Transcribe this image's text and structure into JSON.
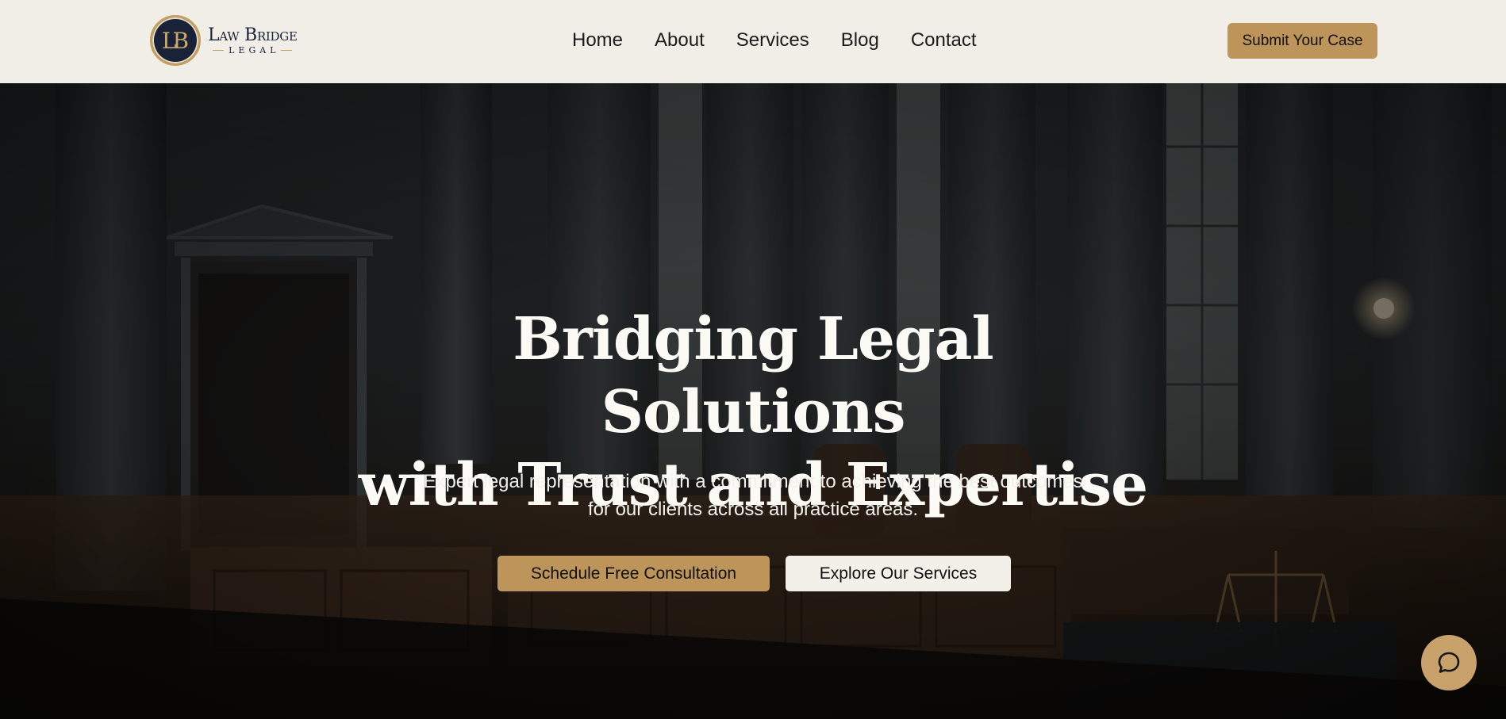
{
  "header": {
    "logo": {
      "monogram": "LB",
      "name": "Law Bridge",
      "tagline": "LEGAL"
    },
    "nav": [
      {
        "label": "Home"
      },
      {
        "label": "About"
      },
      {
        "label": "Services"
      },
      {
        "label": "Blog"
      },
      {
        "label": "Contact"
      }
    ],
    "cta_label": "Submit Your Case"
  },
  "hero": {
    "title_line1": "Bridging Legal Solutions",
    "title_line2": "with Trust and Expertise",
    "subtitle_line1": "Expert legal representation with a commitment to achieving the best outcomes",
    "subtitle_line2": "for our clients across all practice areas.",
    "primary_button": "Schedule Free Consultation",
    "secondary_button": "Explore Our Services"
  },
  "chat": {
    "icon": "chat-bubble-icon"
  },
  "colors": {
    "header_bg": "#f1eee7",
    "accent_gold": "#bd955a",
    "navy": "#1a2238",
    "hero_text": "#fcfaf5"
  }
}
